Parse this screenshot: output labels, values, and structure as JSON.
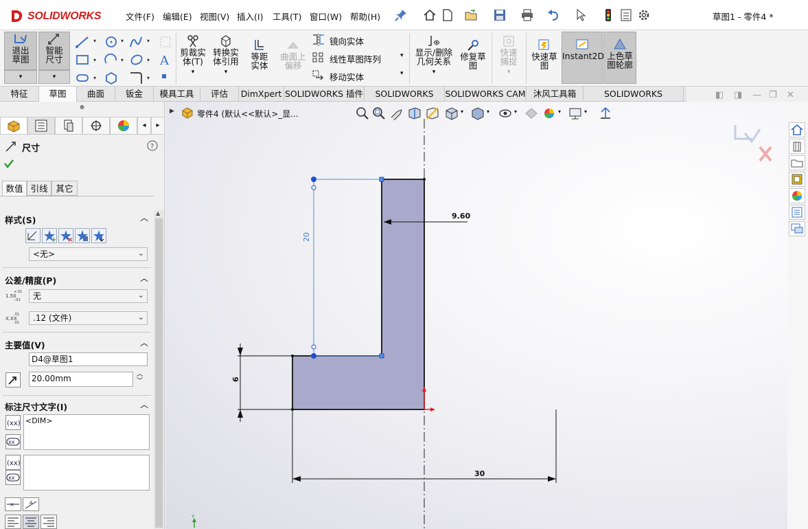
{
  "app": {
    "brand": "SOLIDWORKS",
    "doc_title": "草图1 - 零件4 *"
  },
  "menu": [
    "文件(F)",
    "编辑(E)",
    "视图(V)",
    "插入(I)",
    "工具(T)",
    "窗口(W)",
    "帮助(H)"
  ],
  "ribbon": {
    "exit_sketch": "退出草图",
    "smart_dim": "智能尺寸",
    "trim": "剪裁实体(T)",
    "convert": "转换实体引用",
    "offset": "等距实体",
    "surface_offset": "曲面上偏移",
    "mirror": "镜向实体",
    "linear_pattern": "线性草图阵列",
    "move": "移动实体",
    "display_delete": "显示/删除几何关系",
    "repair": "修复草图",
    "quick_snap": "快速捕捉",
    "rapid_sketch": "快速草图",
    "instant2d": "Instant2D",
    "shaded_contours": "上色草图轮廓"
  },
  "tabs": [
    "特征",
    "草图",
    "曲面",
    "钣金",
    "模具工具",
    "评估",
    "DimXpert",
    "SOLIDWORKS 插件",
    "SOLIDWORKS MBD",
    "SOLIDWORKS CAM",
    "沐风工具箱",
    "SOLIDWORKS Inspection"
  ],
  "active_tab": "草图",
  "panel": {
    "title": "尺寸",
    "subtabs": [
      "数值",
      "引线",
      "其它"
    ],
    "style": {
      "header": "样式(S)",
      "value": "<无>"
    },
    "tolerance": {
      "header": "公差/精度(P)",
      "tol_type": "无",
      "precision": ".12 (文件)"
    },
    "primary": {
      "header": "主要值(V)",
      "name": "D4@草图1",
      "value": "20.00mm"
    },
    "dimtext": {
      "header": "标注尺寸文字(I)",
      "text": "<DIM>"
    }
  },
  "viewport": {
    "tree_item": "零件4 (默认<<默认>_显..."
  },
  "sketch": {
    "dim_width": "30",
    "dim_selected": "20",
    "dim_thickness": "9.60",
    "dim_base": "6"
  },
  "colors": {
    "accent": "#d21f1f",
    "sketch_fill": "#a9aacb",
    "selected": "#3a7bd5"
  }
}
